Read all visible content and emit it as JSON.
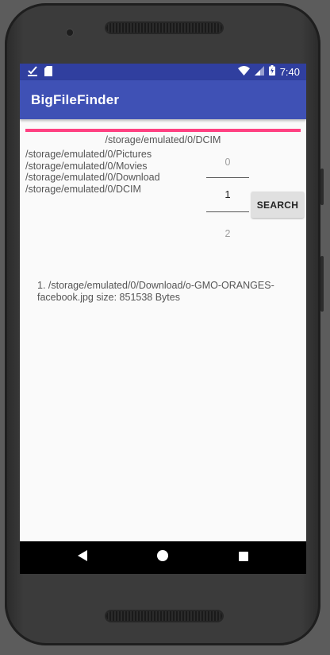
{
  "status_bar": {
    "time": "7:40",
    "left_icons": [
      "download-done-icon",
      "sd-card-icon"
    ],
    "right_icons": [
      "wifi-icon",
      "signal-icon",
      "battery-charging-icon"
    ]
  },
  "app_bar": {
    "title": "BigFileFinder"
  },
  "progress": {
    "value": 1.0,
    "color": "#ff4081"
  },
  "current_path": "/storage/emulated/0/DCIM",
  "directories": [
    "/storage/emulated/0/Pictures",
    "/storage/emulated/0/Movies",
    "/storage/emulated/0/Download",
    "/storage/emulated/0/DCIM"
  ],
  "number_picker": {
    "prev": "0",
    "selected": "1",
    "next": "2"
  },
  "search_button": {
    "label": "SEARCH"
  },
  "results": [
    "1. /storage/emulated/0/Download/o-GMO-ORANGES-facebook.jpg size: 851538 Bytes"
  ],
  "nav_bar": {
    "icons": [
      "back-icon",
      "home-icon",
      "recents-icon"
    ]
  },
  "colors": {
    "primary": "#3f51b5",
    "primary_dark": "#303f9f",
    "accent": "#ff4081"
  }
}
